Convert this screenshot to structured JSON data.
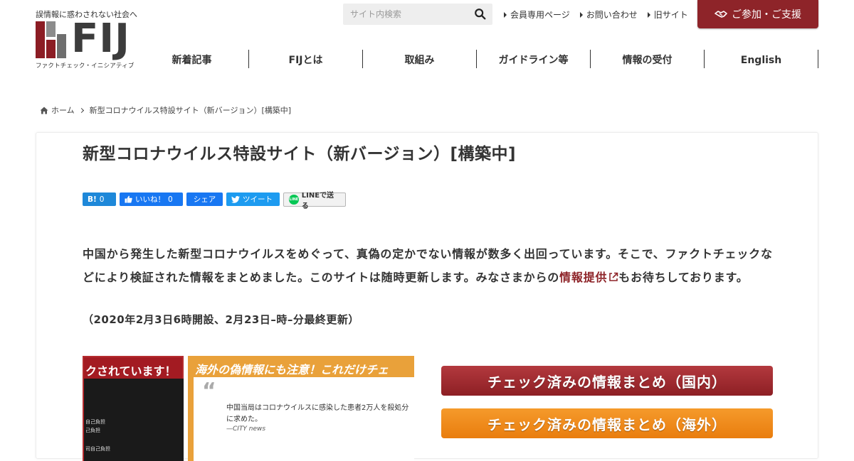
{
  "header": {
    "tagline": "誤情報に惑わされない社会へ",
    "logo_text": "FIJ",
    "logo_subtitle": "ファクトチェック・イニシアティブ",
    "search_placeholder": "サイト内検索",
    "top_links": [
      "会員専用ページ",
      "お問い合わせ",
      "旧サイト"
    ],
    "join_label": "ご参加・ご支援",
    "accent_color": "#8e2429"
  },
  "nav": [
    "新着記事",
    "FIJとは",
    "取組み",
    "ガイドライン等",
    "情報の受付",
    "English"
  ],
  "breadcrumb": {
    "home": "ホーム",
    "current": "新型コロナウイルス特設サイト（新バージョン）[構築中]"
  },
  "article": {
    "title": "新型コロナウイルス特設サイト（新バージョン）[構築中]",
    "share": {
      "hatena_label": "B!",
      "hatena_count": "0",
      "fb_like_label": "いいね！",
      "fb_like_count": "0",
      "fb_share_label": "シェア",
      "tweet_label": "ツイート",
      "line_label": "LINEで送る"
    },
    "body_before_link": "中国から発生した新型コロナウイルスをめぐって、真偽の定かでない情報が数多く出回っています。そこで、ファクトチェックなどにより検証された情報をまとめました。このサイトは随時更新します。みなさまからの",
    "body_link": "情報提供",
    "body_after_link": "もお待ちしております。",
    "date_note": "（2020年2月3日6時開設、2月23日–時–分最終更新）",
    "thumbnail": {
      "left_caption": "クされています！",
      "left_line1": "自己負担",
      "left_line2": "己負担",
      "left_line3": "司自己負担",
      "right_caption": "海外の偽情報にも注意！これだけチェ",
      "quote_line1": "中国当局はコロナウイルスに感染した患者2万人を殺処分",
      "quote_line2": "に求めた。",
      "quote_source": "—CITY news"
    },
    "cta_domestic": "チェック済みの情報まとめ（国内）",
    "cta_overseas": "チェック済みの情報まとめ（海外）"
  }
}
